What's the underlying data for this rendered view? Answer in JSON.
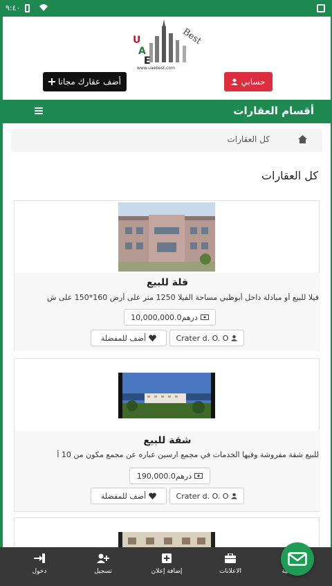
{
  "status": {
    "time": "٩:٤٠"
  },
  "logo": {
    "brand_letters": [
      "U",
      "A",
      "E"
    ],
    "word": "Best",
    "site": "www.uaebest.com"
  },
  "header": {
    "account_label": "حسابي",
    "add_property_label": "أضف عقارك مجانا"
  },
  "navbar": {
    "title": "أقسام العقارات"
  },
  "breadcrumb": {
    "current": "كل العقارات"
  },
  "page_heading": "كل العقارات",
  "listings": [
    {
      "title": "فلة للبيع",
      "description": "فيلا للبيع أو مبادلة داخل أبوظبي مساحة الفيلا 1250 متر على أرض 160*150 على ش",
      "price": "10,000,000.0درهم",
      "owner": "Crater d. O. O",
      "favorite_label": "أضف للمفضلة"
    },
    {
      "title": "شقة للبيع",
      "description": "للبيع شقة مفروشة وفيها الخدمات في مجمع ارسين عباره عن مجمع مكون من 10 أ",
      "price": "190,000.0درهم",
      "owner": "Crater d. O. O",
      "favorite_label": "أضف للمفضلة"
    }
  ],
  "bottom_nav": {
    "home": "الرئيسية",
    "ads": "الاعلانات",
    "add_ad": "إضافة إعلان",
    "register": "تسجيل",
    "login": "دخول"
  },
  "colors": {
    "primary_green": "#1e8a52",
    "account_red": "#dc2e3e",
    "nav_dark": "#383838"
  }
}
